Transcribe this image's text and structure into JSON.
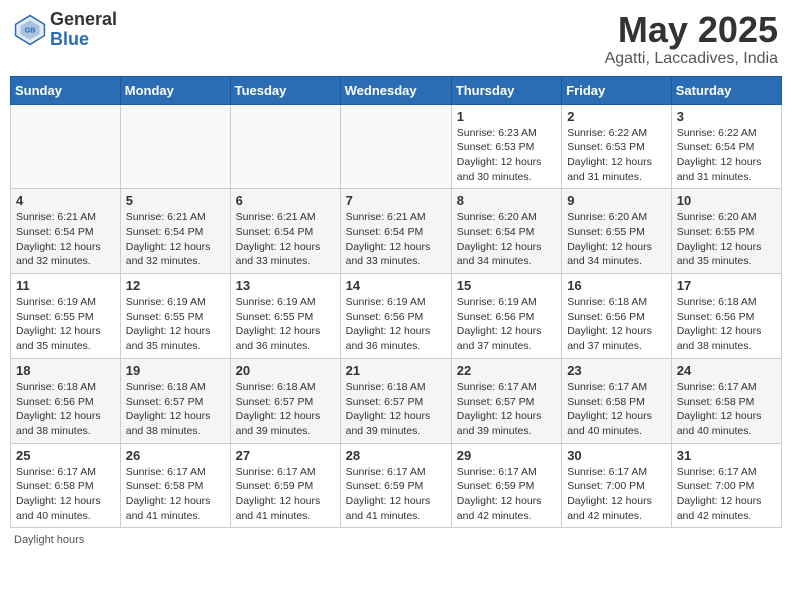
{
  "header": {
    "logo_general": "General",
    "logo_blue": "Blue",
    "month_title": "May 2025",
    "location": "Agatti, Laccadives, India"
  },
  "weekdays": [
    "Sunday",
    "Monday",
    "Tuesday",
    "Wednesday",
    "Thursday",
    "Friday",
    "Saturday"
  ],
  "footer": "Daylight hours",
  "weeks": [
    [
      {
        "day": "",
        "info": ""
      },
      {
        "day": "",
        "info": ""
      },
      {
        "day": "",
        "info": ""
      },
      {
        "day": "",
        "info": ""
      },
      {
        "day": "1",
        "info": "Sunrise: 6:23 AM\nSunset: 6:53 PM\nDaylight: 12 hours and 30 minutes."
      },
      {
        "day": "2",
        "info": "Sunrise: 6:22 AM\nSunset: 6:53 PM\nDaylight: 12 hours and 31 minutes."
      },
      {
        "day": "3",
        "info": "Sunrise: 6:22 AM\nSunset: 6:54 PM\nDaylight: 12 hours and 31 minutes."
      }
    ],
    [
      {
        "day": "4",
        "info": "Sunrise: 6:21 AM\nSunset: 6:54 PM\nDaylight: 12 hours and 32 minutes."
      },
      {
        "day": "5",
        "info": "Sunrise: 6:21 AM\nSunset: 6:54 PM\nDaylight: 12 hours and 32 minutes."
      },
      {
        "day": "6",
        "info": "Sunrise: 6:21 AM\nSunset: 6:54 PM\nDaylight: 12 hours and 33 minutes."
      },
      {
        "day": "7",
        "info": "Sunrise: 6:21 AM\nSunset: 6:54 PM\nDaylight: 12 hours and 33 minutes."
      },
      {
        "day": "8",
        "info": "Sunrise: 6:20 AM\nSunset: 6:54 PM\nDaylight: 12 hours and 34 minutes."
      },
      {
        "day": "9",
        "info": "Sunrise: 6:20 AM\nSunset: 6:55 PM\nDaylight: 12 hours and 34 minutes."
      },
      {
        "day": "10",
        "info": "Sunrise: 6:20 AM\nSunset: 6:55 PM\nDaylight: 12 hours and 35 minutes."
      }
    ],
    [
      {
        "day": "11",
        "info": "Sunrise: 6:19 AM\nSunset: 6:55 PM\nDaylight: 12 hours and 35 minutes."
      },
      {
        "day": "12",
        "info": "Sunrise: 6:19 AM\nSunset: 6:55 PM\nDaylight: 12 hours and 35 minutes."
      },
      {
        "day": "13",
        "info": "Sunrise: 6:19 AM\nSunset: 6:55 PM\nDaylight: 12 hours and 36 minutes."
      },
      {
        "day": "14",
        "info": "Sunrise: 6:19 AM\nSunset: 6:56 PM\nDaylight: 12 hours and 36 minutes."
      },
      {
        "day": "15",
        "info": "Sunrise: 6:19 AM\nSunset: 6:56 PM\nDaylight: 12 hours and 37 minutes."
      },
      {
        "day": "16",
        "info": "Sunrise: 6:18 AM\nSunset: 6:56 PM\nDaylight: 12 hours and 37 minutes."
      },
      {
        "day": "17",
        "info": "Sunrise: 6:18 AM\nSunset: 6:56 PM\nDaylight: 12 hours and 38 minutes."
      }
    ],
    [
      {
        "day": "18",
        "info": "Sunrise: 6:18 AM\nSunset: 6:56 PM\nDaylight: 12 hours and 38 minutes."
      },
      {
        "day": "19",
        "info": "Sunrise: 6:18 AM\nSunset: 6:57 PM\nDaylight: 12 hours and 38 minutes."
      },
      {
        "day": "20",
        "info": "Sunrise: 6:18 AM\nSunset: 6:57 PM\nDaylight: 12 hours and 39 minutes."
      },
      {
        "day": "21",
        "info": "Sunrise: 6:18 AM\nSunset: 6:57 PM\nDaylight: 12 hours and 39 minutes."
      },
      {
        "day": "22",
        "info": "Sunrise: 6:17 AM\nSunset: 6:57 PM\nDaylight: 12 hours and 39 minutes."
      },
      {
        "day": "23",
        "info": "Sunrise: 6:17 AM\nSunset: 6:58 PM\nDaylight: 12 hours and 40 minutes."
      },
      {
        "day": "24",
        "info": "Sunrise: 6:17 AM\nSunset: 6:58 PM\nDaylight: 12 hours and 40 minutes."
      }
    ],
    [
      {
        "day": "25",
        "info": "Sunrise: 6:17 AM\nSunset: 6:58 PM\nDaylight: 12 hours and 40 minutes."
      },
      {
        "day": "26",
        "info": "Sunrise: 6:17 AM\nSunset: 6:58 PM\nDaylight: 12 hours and 41 minutes."
      },
      {
        "day": "27",
        "info": "Sunrise: 6:17 AM\nSunset: 6:59 PM\nDaylight: 12 hours and 41 minutes."
      },
      {
        "day": "28",
        "info": "Sunrise: 6:17 AM\nSunset: 6:59 PM\nDaylight: 12 hours and 41 minutes."
      },
      {
        "day": "29",
        "info": "Sunrise: 6:17 AM\nSunset: 6:59 PM\nDaylight: 12 hours and 42 minutes."
      },
      {
        "day": "30",
        "info": "Sunrise: 6:17 AM\nSunset: 7:00 PM\nDaylight: 12 hours and 42 minutes."
      },
      {
        "day": "31",
        "info": "Sunrise: 6:17 AM\nSunset: 7:00 PM\nDaylight: 12 hours and 42 minutes."
      }
    ]
  ]
}
